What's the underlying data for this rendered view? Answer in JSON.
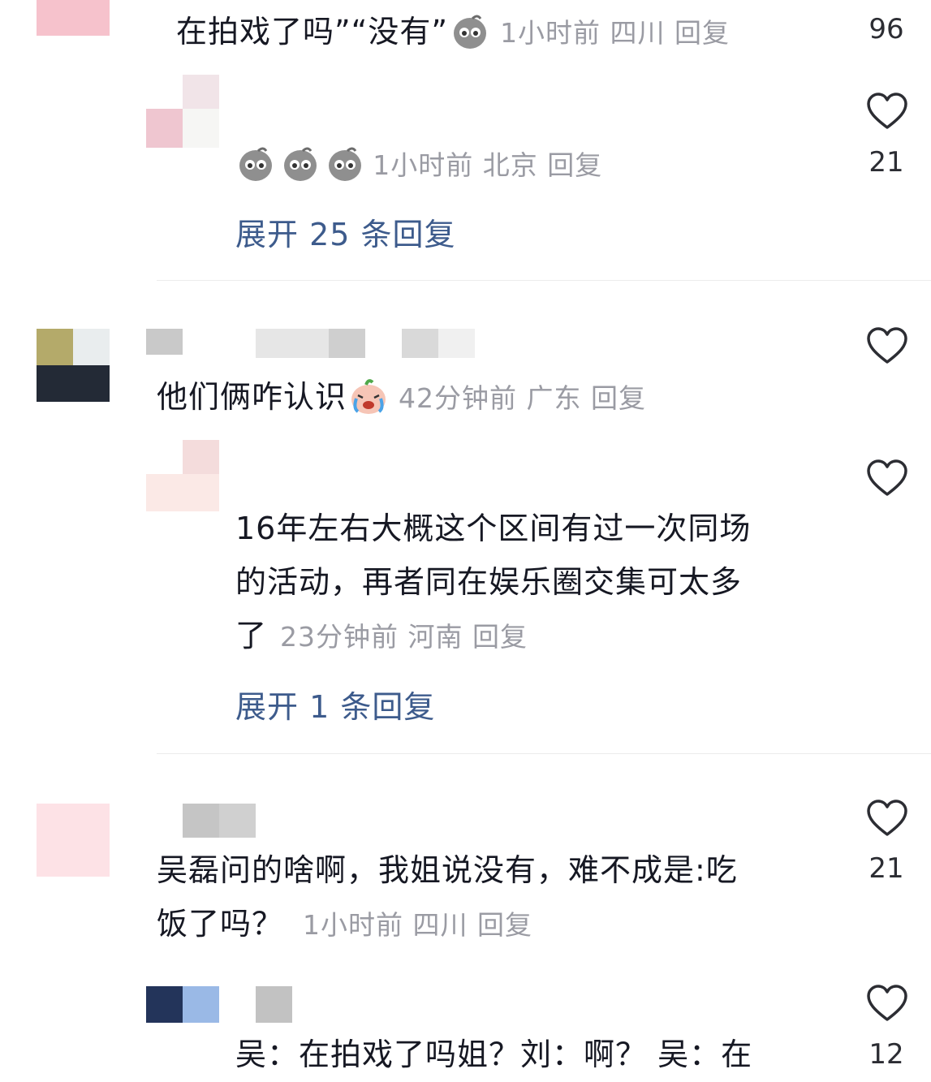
{
  "comments": [
    {
      "text_tail": "在拍戏了吗”“没有”",
      "meta": "1小时前 四川 回复",
      "likes": "96"
    },
    {
      "meta": "1小时前 北京 回复",
      "likes": "21",
      "expand": "展开 25 条回复"
    },
    {
      "text": "他们俩咋认识",
      "meta": "42分钟前 广东 回复",
      "likes": ""
    },
    {
      "lines": [
        "16年左右大概这个区间有过一次同场",
        "的活动，再者同在娱乐圈交集可太多",
        "了"
      ],
      "meta": "23分钟前 河南 回复",
      "likes": "",
      "expand": "展开 1 条回复"
    },
    {
      "lines": [
        "吴磊问的啥啊，我姐说没有，难不成是:吃",
        "饭了吗？"
      ],
      "meta": "1小时前 四川 回复",
      "likes": "21"
    },
    {
      "text": "吴：在拍戏了吗姐？刘：啊？  吴：在",
      "likes": "12"
    }
  ],
  "colors": {
    "accent_link": "#3d5b8c",
    "meta_gray": "#9a9ba3"
  }
}
